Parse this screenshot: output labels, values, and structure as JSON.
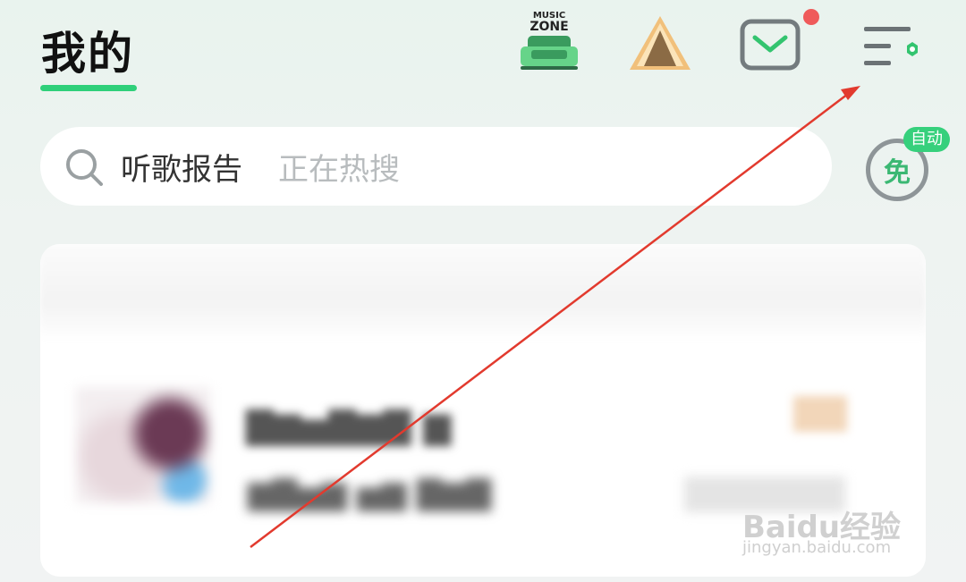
{
  "header": {
    "title": "我的"
  },
  "top_icons": {
    "music_zone": {
      "line1": "MUSIC",
      "line2": "ZONE",
      "icon": "music-zone-sofa-icon"
    },
    "camp": {
      "icon": "tent-icon"
    },
    "mail": {
      "icon": "mail-icon",
      "has_notification_dot": true
    },
    "settings": {
      "icon": "settings-menu-icon"
    }
  },
  "search": {
    "query": "听歌报告",
    "hint": "正在热搜",
    "icon": "search-icon"
  },
  "free_mode": {
    "label": "免",
    "badge": "自动"
  },
  "watermark": {
    "main": "Baidu经验",
    "sub": "jingyan.baidu.com"
  },
  "colors": {
    "accent": "#2fd07a",
    "badge_red": "#ef5a5a",
    "arrow_red": "#e23a2e"
  }
}
